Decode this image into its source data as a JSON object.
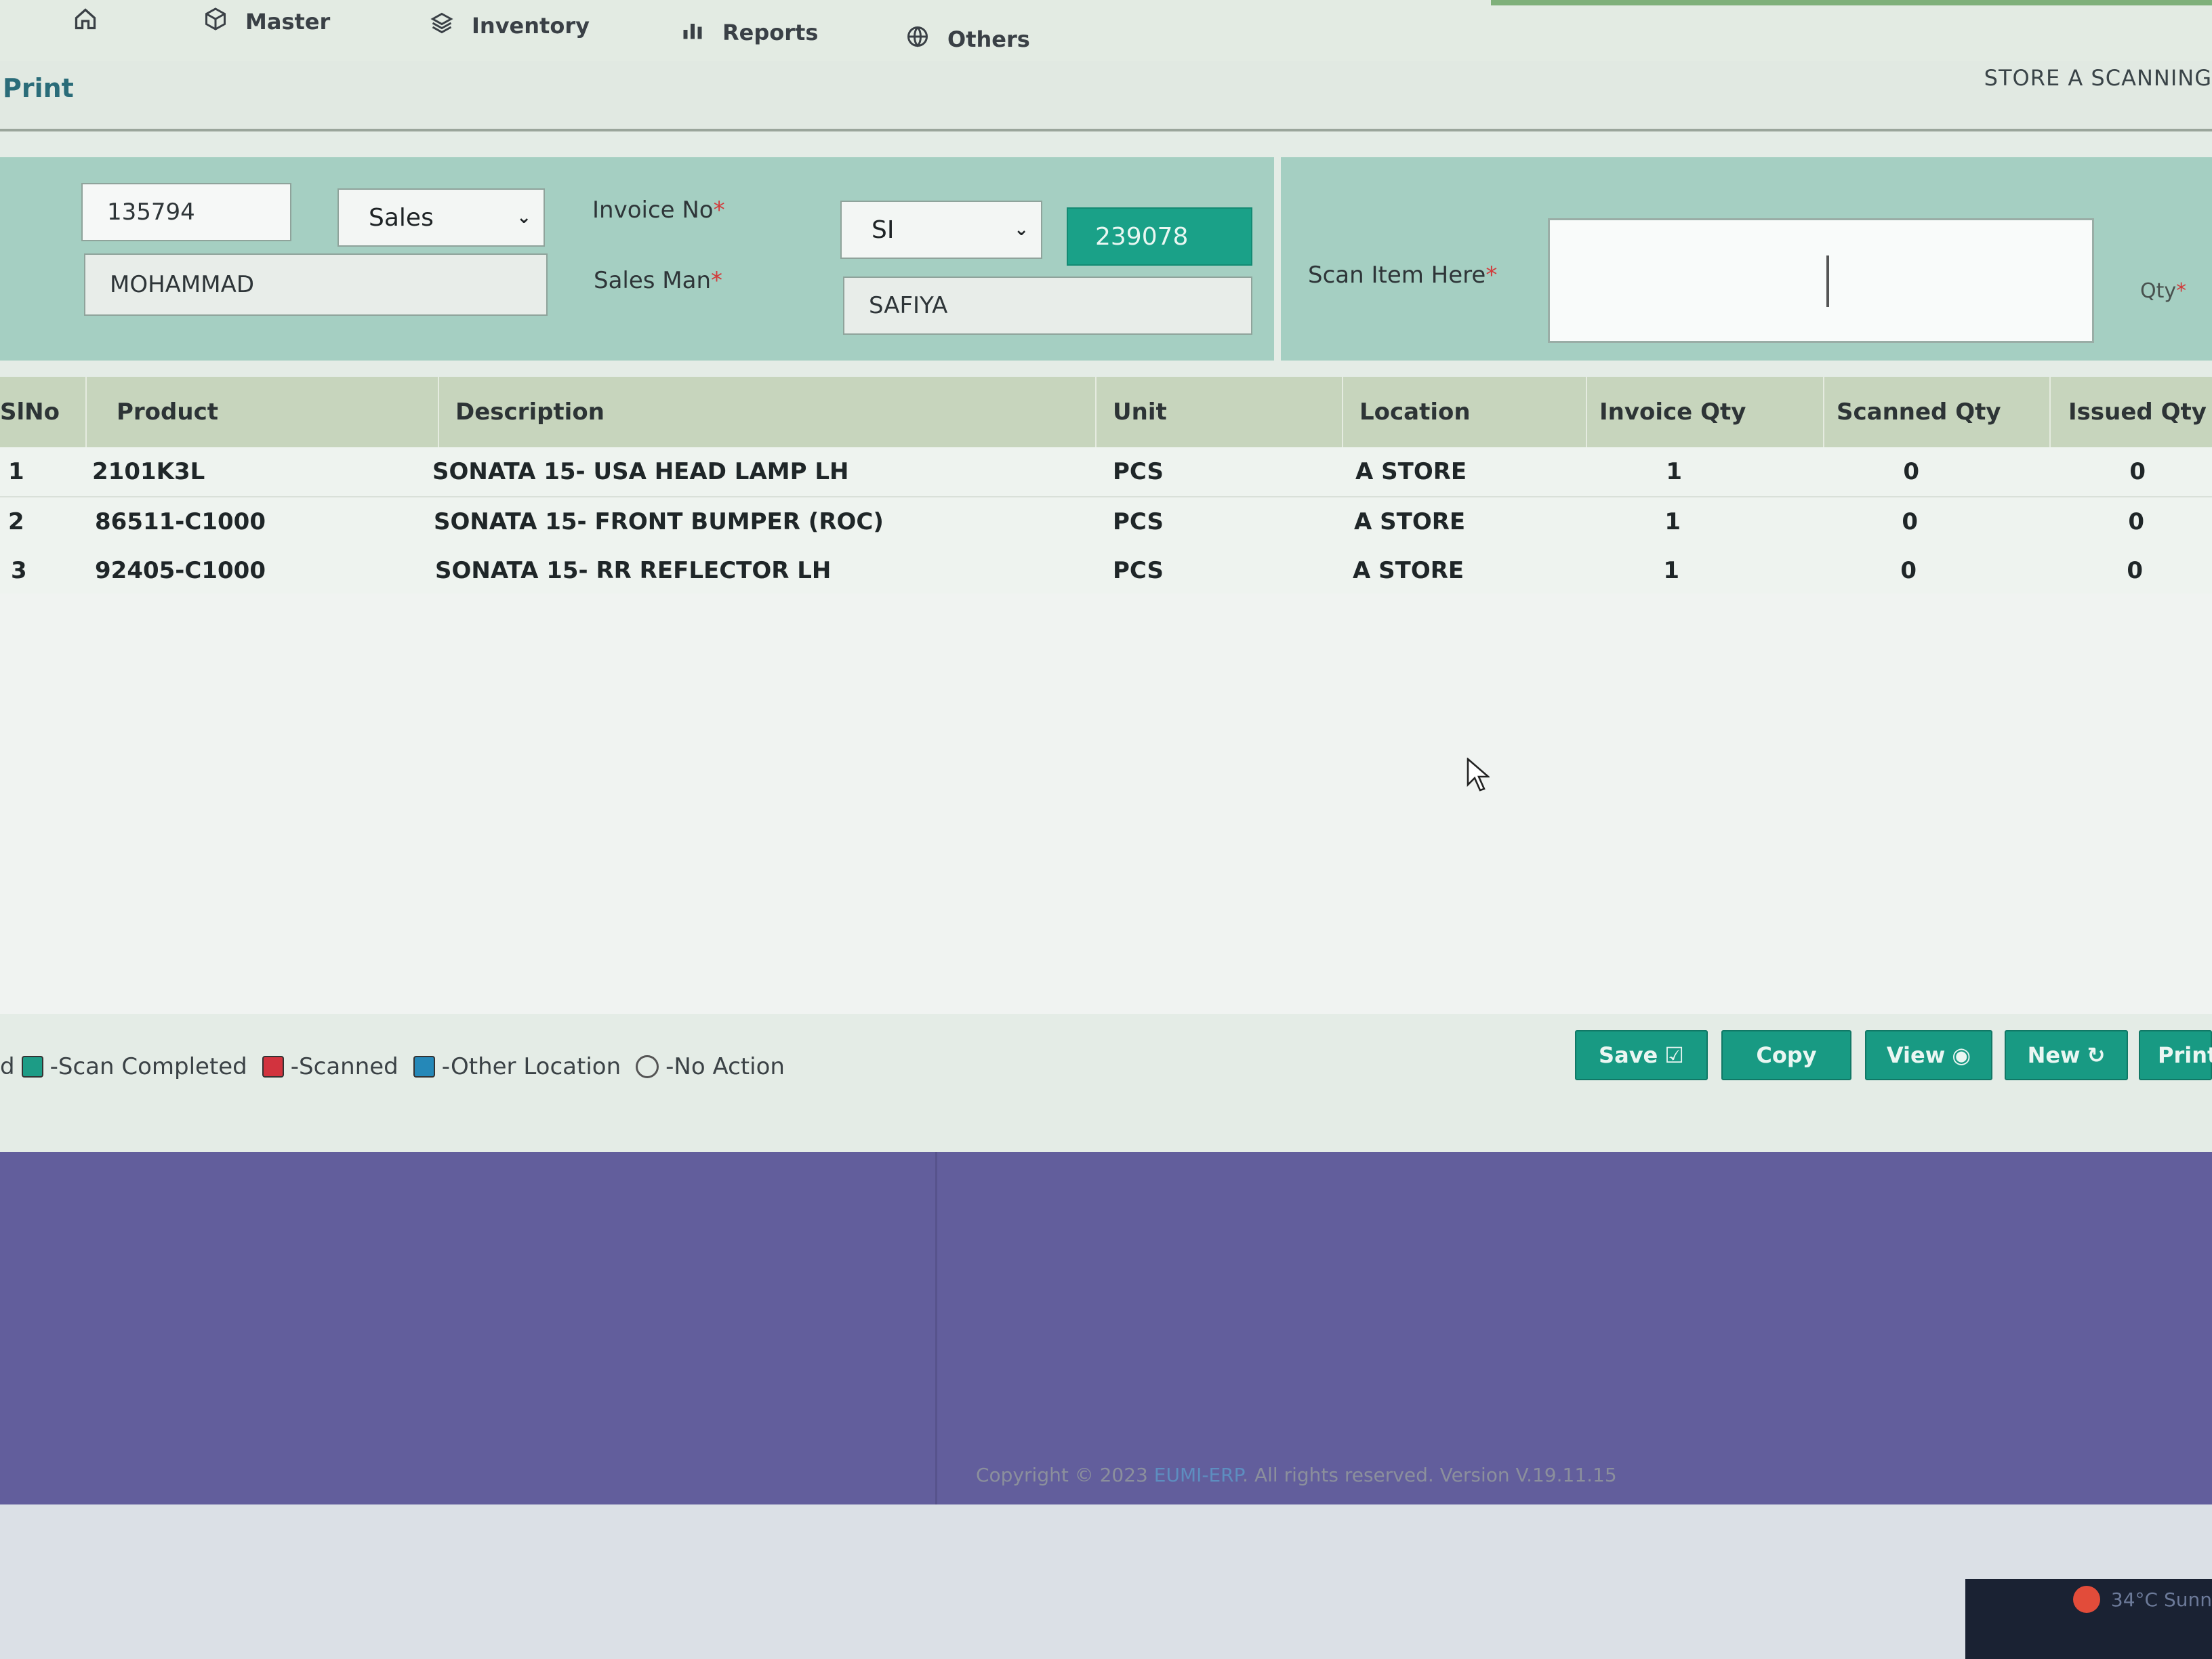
{
  "nav": {
    "items": [
      {
        "label": "",
        "icon": "home-icon"
      },
      {
        "label": "Master",
        "icon": "cube-icon"
      },
      {
        "label": "Inventory",
        "icon": "layers-icon"
      },
      {
        "label": "Reports",
        "icon": "bar-chart-icon"
      },
      {
        "label": "Others",
        "icon": "globe-icon"
      }
    ]
  },
  "toolbar": {
    "print_label": "Print",
    "page_title": "STORE A SCANNING"
  },
  "form": {
    "customer_code": "135794",
    "type_select": "Sales",
    "invoice_label": "Invoice No",
    "invoice_prefix": "SI",
    "invoice_number": "239078",
    "customer_name": "MOHAMMAD",
    "salesman_label": "Sales Man",
    "salesman_value": "SAFIYA",
    "required_mark": "*",
    "scan_label": "Scan Item Here",
    "qty_label": "Qty",
    "scan_value": ""
  },
  "table": {
    "columns": [
      "SlNo",
      "Product",
      "Description",
      "Unit",
      "Location",
      "Invoice Qty",
      "Scanned Qty",
      "Issued Qty"
    ],
    "rows": [
      {
        "slno": "1",
        "product": "2101K3L",
        "description": "SONATA 15- USA HEAD LAMP LH",
        "unit": "PCS",
        "location": "A STORE",
        "invoice_qty": "1",
        "scanned_qty": "0",
        "issued_qty": "0"
      },
      {
        "slno": "2",
        "product": "86511-C1000",
        "description": "SONATA 15- FRONT BUMPER (ROC)",
        "unit": "PCS",
        "location": "A STORE",
        "invoice_qty": "1",
        "scanned_qty": "0",
        "issued_qty": "0"
      },
      {
        "slno": "3",
        "product": "92405-C1000",
        "description": "SONATA 15- RR REFLECTOR LH",
        "unit": "PCS",
        "location": "A STORE",
        "invoice_qty": "1",
        "scanned_qty": "0",
        "issued_qty": "0"
      }
    ]
  },
  "legend": {
    "lead": "d",
    "items": [
      {
        "label": "-Scan Completed",
        "color": "#1d9c86"
      },
      {
        "label": "-Scanned",
        "color": "#d2333e"
      },
      {
        "label": "-Other Location",
        "color": "#2588b8"
      },
      {
        "label": "-No Action",
        "color": "none"
      }
    ]
  },
  "actions": {
    "save": "Save",
    "copy": "Copy",
    "view": "View",
    "new": "New",
    "print": "Print"
  },
  "footer": {
    "copyright_prefix": "Copyright © 2023",
    "brand": "EUMI-ERP",
    "copyright_suffix": ". All rights reserved. Version V.19.11.15"
  },
  "system": {
    "weather": "34°C Sunn"
  },
  "colors": {
    "accent": "#1aa188",
    "panel": "#a5cfc2",
    "footer": "#625e9c",
    "required": "#d23b3b"
  }
}
